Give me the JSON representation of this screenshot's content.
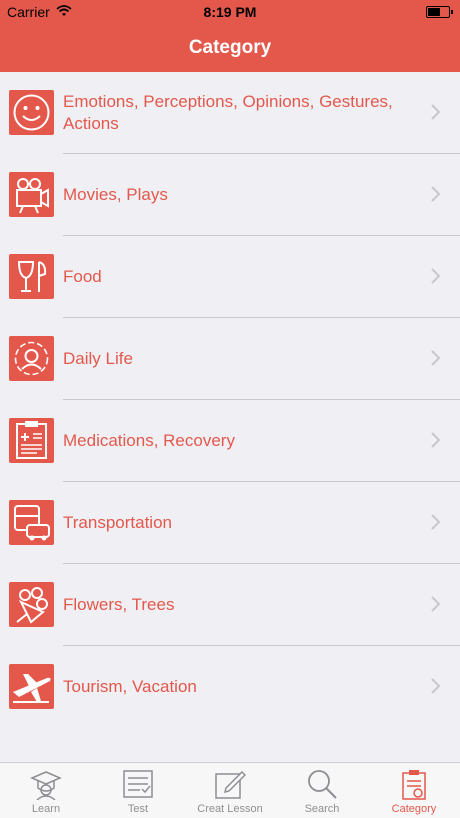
{
  "status": {
    "carrier": "Carrier",
    "time": "8:19 PM"
  },
  "nav": {
    "title": "Category"
  },
  "categories": [
    {
      "label": "Emotions, Perceptions, Opinions, Gestures, Actions",
      "icon": "smiley-face-icon"
    },
    {
      "label": "Movies, Plays",
      "icon": "movie-camera-icon"
    },
    {
      "label": "Food",
      "icon": "glass-fork-icon"
    },
    {
      "label": "Daily Life",
      "icon": "person-cycle-icon"
    },
    {
      "label": "Medications, Recovery",
      "icon": "medical-chart-icon"
    },
    {
      "label": "Transportation",
      "icon": "bus-car-icon"
    },
    {
      "label": "Flowers, Trees",
      "icon": "bouquet-icon"
    },
    {
      "label": "Tourism, Vacation",
      "icon": "airplane-icon"
    }
  ],
  "tabs": [
    {
      "label": "Learn",
      "icon": "graduation-cap-icon"
    },
    {
      "label": "Test",
      "icon": "checklist-icon"
    },
    {
      "label": "Creat Lesson",
      "icon": "pencil-edit-icon"
    },
    {
      "label": "Search",
      "icon": "magnifier-icon"
    },
    {
      "label": "Category",
      "icon": "clipboard-icon",
      "active": true
    }
  ],
  "colors": {
    "accent": "#e4584c",
    "background": "#efeff4",
    "inactive_tab": "#8e8e93"
  }
}
